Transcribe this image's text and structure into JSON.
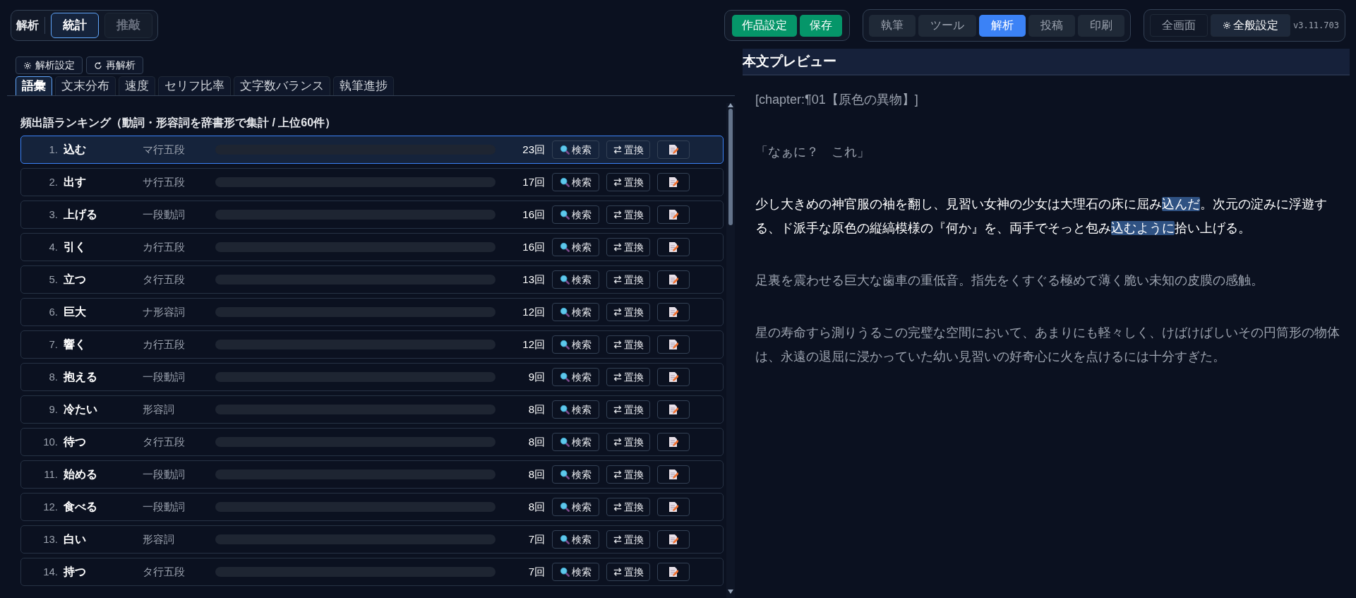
{
  "mode_group": {
    "label": "解析",
    "tabs": [
      {
        "label": "統計",
        "selected": true
      },
      {
        "label": "推敲",
        "selected": false
      }
    ]
  },
  "project_buttons": [
    "作品設定",
    "保存"
  ],
  "main_tabs": [
    {
      "label": "執筆",
      "selected": false
    },
    {
      "label": "ツール",
      "selected": false
    },
    {
      "label": "解析",
      "selected": true
    },
    {
      "label": "投稿",
      "selected": false
    },
    {
      "label": "印刷",
      "selected": false
    }
  ],
  "view_buttons": [
    {
      "label": "全画面",
      "kind": "plain"
    },
    {
      "label": "全般設定",
      "kind": "settings"
    }
  ],
  "version": "v3.11.703",
  "tool_buttons": [
    {
      "label": "解析設定",
      "kind": "settings"
    },
    {
      "label": "再解析",
      "kind": "refresh"
    }
  ],
  "analysis_tabs": [
    {
      "label": "語彙",
      "selected": true
    },
    {
      "label": "文末分布",
      "selected": false
    },
    {
      "label": "速度",
      "selected": false
    },
    {
      "label": "セリフ比率",
      "selected": false
    },
    {
      "label": "文字数バランス",
      "selected": false
    },
    {
      "label": "執筆進捗",
      "selected": false
    }
  ],
  "ranking": {
    "title": "頻出語ランキング（動詞・形容詞を辞書形で集計 / 上位60件）",
    "rows": [
      {
        "rank": "1.",
        "word": "込む",
        "type": "マ行五段",
        "count": "23回",
        "search": "検索",
        "replace": "置換",
        "selected": true
      },
      {
        "rank": "2.",
        "word": "出す",
        "type": "サ行五段",
        "count": "17回",
        "search": "検索",
        "replace": "置換",
        "selected": false
      },
      {
        "rank": "3.",
        "word": "上げる",
        "type": "一段動詞",
        "count": "16回",
        "search": "検索",
        "replace": "置換",
        "selected": false
      },
      {
        "rank": "4.",
        "word": "引く",
        "type": "カ行五段",
        "count": "16回",
        "search": "検索",
        "replace": "置換",
        "selected": false
      },
      {
        "rank": "5.",
        "word": "立つ",
        "type": "タ行五段",
        "count": "13回",
        "search": "検索",
        "replace": "置換",
        "selected": false
      },
      {
        "rank": "6.",
        "word": "巨大",
        "type": "ナ形容詞",
        "count": "12回",
        "search": "検索",
        "replace": "置換",
        "selected": false
      },
      {
        "rank": "7.",
        "word": "響く",
        "type": "カ行五段",
        "count": "12回",
        "search": "検索",
        "replace": "置換",
        "selected": false
      },
      {
        "rank": "8.",
        "word": "抱える",
        "type": "一段動詞",
        "count": "9回",
        "search": "検索",
        "replace": "置換",
        "selected": false
      },
      {
        "rank": "9.",
        "word": "冷たい",
        "type": "形容詞",
        "count": "8回",
        "search": "検索",
        "replace": "置換",
        "selected": false
      },
      {
        "rank": "10.",
        "word": "待つ",
        "type": "タ行五段",
        "count": "8回",
        "search": "検索",
        "replace": "置換",
        "selected": false
      },
      {
        "rank": "11.",
        "word": "始める",
        "type": "一段動詞",
        "count": "8回",
        "search": "検索",
        "replace": "置換",
        "selected": false
      },
      {
        "rank": "12.",
        "word": "食べる",
        "type": "一段動詞",
        "count": "8回",
        "search": "検索",
        "replace": "置換",
        "selected": false
      },
      {
        "rank": "13.",
        "word": "白い",
        "type": "形容詞",
        "count": "7回",
        "search": "検索",
        "replace": "置換",
        "selected": false
      },
      {
        "rank": "14.",
        "word": "持つ",
        "type": "タ行五段",
        "count": "7回",
        "search": "検索",
        "replace": "置換",
        "selected": false
      }
    ]
  },
  "preview": {
    "title": "本文プレビュー",
    "paragraphs": [
      {
        "active": false,
        "segments": [
          {
            "text": "[chapter:¶01【原色の異物】]",
            "highlight": false
          }
        ]
      },
      {
        "active": false,
        "segments": [
          {
            "text": "「なぁに？　これ」",
            "highlight": false
          }
        ]
      },
      {
        "active": true,
        "segments": [
          {
            "text": "少し大きめの神官服の袖を翻し、見習い女神の少女は大理石の床に屈み",
            "highlight": false
          },
          {
            "text": "込んだ",
            "highlight": true
          },
          {
            "text": "。次元の淀みに浮遊する、ド派手な原色の縦縞模様の『何か』を、両手でそっと包み",
            "highlight": false
          },
          {
            "text": "込むように",
            "highlight": true
          },
          {
            "text": "拾い上げる。",
            "highlight": false
          }
        ]
      },
      {
        "active": false,
        "segments": [
          {
            "text": "足裏を震わせる巨大な歯車の重低音。指先をくすぐる極めて薄く脆い未知の皮膜の感触。",
            "highlight": false
          }
        ]
      },
      {
        "active": false,
        "segments": [
          {
            "text": "星の寿命すら測りうるこの完璧な空間において、あまりにも軽々しく、けばけばしいその円筒形の物体は、永遠の退屈に浸かっていた幼い見習いの好奇心に火を点けるには十分すぎた。",
            "highlight": false
          }
        ]
      }
    ]
  }
}
